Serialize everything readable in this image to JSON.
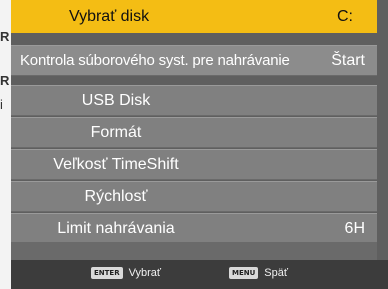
{
  "background": {
    "fragments": [
      "R",
      "R",
      "i"
    ]
  },
  "menu": {
    "title": {
      "label": "Vybrať disk",
      "value": "C:"
    },
    "items": [
      {
        "label": "Kontrola súborového syst. pre nahrávanie",
        "value": "Štart"
      },
      {
        "label": "USB Disk",
        "value": ""
      },
      {
        "label": "Formát",
        "value": ""
      },
      {
        "label": "Veľkosť TimeShift",
        "value": ""
      },
      {
        "label": "Rýchlosť",
        "value": ""
      },
      {
        "label": "Limit nahrávania",
        "value": "6H"
      }
    ]
  },
  "footer": {
    "select": {
      "key": "ENTER",
      "label": "Vybrať"
    },
    "back": {
      "key": "MENU",
      "label": "Späť"
    }
  },
  "colors": {
    "title_bg": "#f4bd14",
    "row_bg": "#808080",
    "footer_bg": "#3c3c3c"
  }
}
